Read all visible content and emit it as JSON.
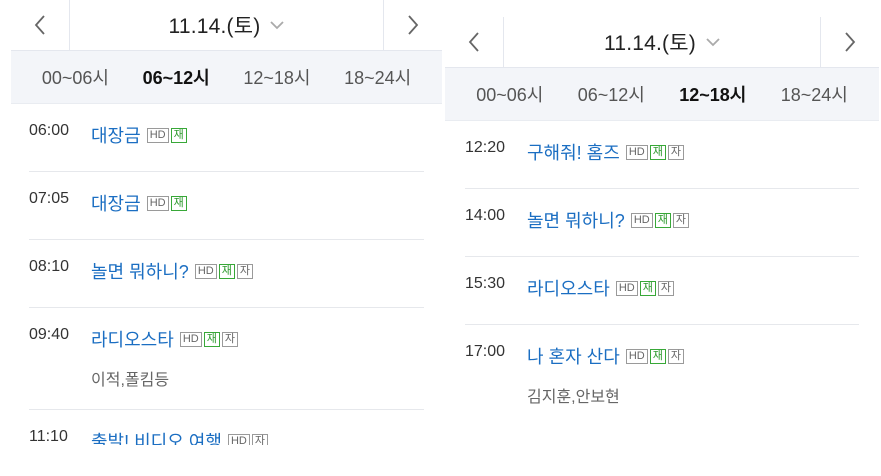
{
  "left": {
    "date": "11.14.(토)",
    "tabs": [
      "00~06시",
      "06~12시",
      "12~18시",
      "18~24시"
    ],
    "active_tab": 1,
    "programs": [
      {
        "time": "06:00",
        "title": "대장금",
        "badges": [
          "HD",
          "재"
        ],
        "cast": ""
      },
      {
        "time": "07:05",
        "title": "대장금",
        "badges": [
          "HD",
          "재"
        ],
        "cast": ""
      },
      {
        "time": "08:10",
        "title": "놀면 뭐하니?",
        "badges": [
          "HD",
          "재",
          "자"
        ],
        "cast": ""
      },
      {
        "time": "09:40",
        "title": "라디오스타",
        "badges": [
          "HD",
          "재",
          "자"
        ],
        "cast": "이적,폴킴등"
      },
      {
        "time": "11:10",
        "title": "출발! 비디오 여행",
        "badges": [
          "HD",
          "자"
        ],
        "cast": ""
      }
    ]
  },
  "right": {
    "date": "11.14.(토)",
    "tabs": [
      "00~06시",
      "06~12시",
      "12~18시",
      "18~24시"
    ],
    "active_tab": 2,
    "programs": [
      {
        "time": "12:20",
        "title": "구해줘! 홈즈",
        "badges": [
          "HD",
          "재",
          "자"
        ],
        "cast": ""
      },
      {
        "time": "14:00",
        "title": "놀면 뭐하니?",
        "badges": [
          "HD",
          "재",
          "자"
        ],
        "cast": ""
      },
      {
        "time": "15:30",
        "title": "라디오스타",
        "badges": [
          "HD",
          "재",
          "자"
        ],
        "cast": ""
      },
      {
        "time": "17:00",
        "title": "나 혼자 산다",
        "badges": [
          "HD",
          "재",
          "자"
        ],
        "cast": "김지훈,안보현"
      }
    ]
  },
  "colors": {
    "title_link": "#1b6ec2",
    "rerun_badge": "#38a838",
    "tab_bar_bg": "#f3f5f9"
  },
  "icons": {
    "prev": "chevron-left-icon",
    "next": "chevron-right-icon",
    "dropdown": "chevron-down-icon"
  }
}
